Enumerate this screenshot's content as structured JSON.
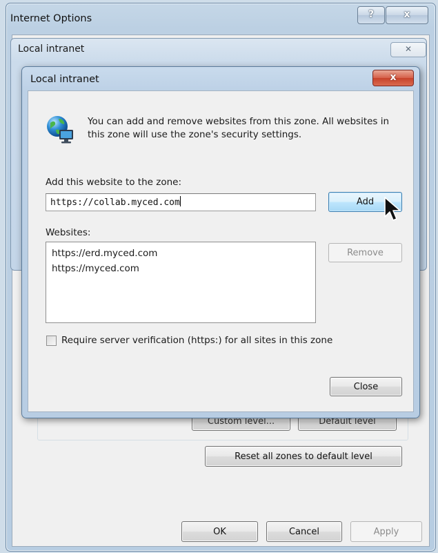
{
  "outer_window": {
    "title": "Internet Options",
    "help_glyph": "?",
    "close_glyph": "x"
  },
  "middle_dialog": {
    "title": "Local intranet",
    "close_glyph": "✕"
  },
  "background_buttons": {
    "custom_level": "Custom level...",
    "default_level": "Default level",
    "reset_all": "Reset all zones to default level",
    "ok": "OK",
    "cancel": "Cancel",
    "apply": "Apply"
  },
  "inner_dialog": {
    "title": "Local intranet",
    "close_glyph": "x",
    "info_text": "You can add and remove websites from this zone. All websites in this zone will use the zone's security settings.",
    "add_label": "Add this website to the zone:",
    "add_value": "https://collab.myced.com",
    "add_button": "Add",
    "websites_label": "Websites:",
    "websites": [
      "https://erd.myced.com",
      "https://myced.com"
    ],
    "remove_button": "Remove",
    "require_verification": {
      "label": "Require server verification (https:) for all sites in this zone",
      "checked": false
    },
    "close_button": "Close"
  },
  "icons": {
    "globe": "globe-computer-icon",
    "cursor": "mouse-pointer-icon"
  }
}
